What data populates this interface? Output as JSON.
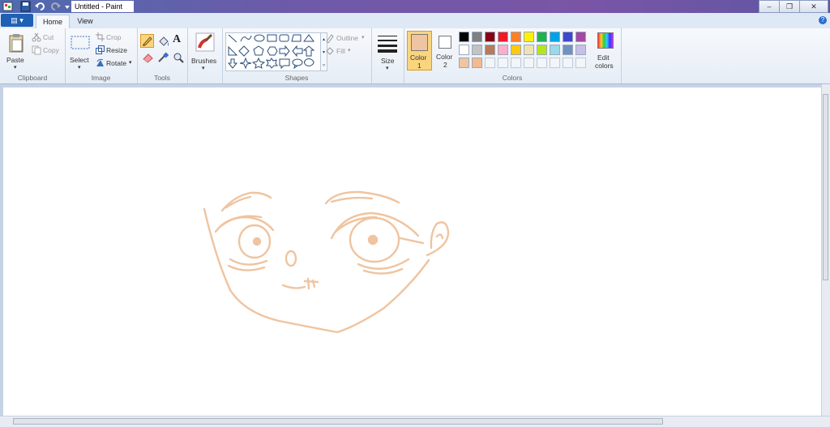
{
  "window": {
    "title": "Untitled - Paint"
  },
  "tabs": {
    "home": "Home",
    "view": "View"
  },
  "clipboard": {
    "paste": "Paste",
    "cut": "Cut",
    "copy": "Copy",
    "label": "Clipboard"
  },
  "image": {
    "select": "Select",
    "crop": "Crop",
    "resize": "Resize",
    "rotate": "Rotate",
    "label": "Image"
  },
  "tools": {
    "label": "Tools"
  },
  "brushes": {
    "label": "Brushes"
  },
  "shapes": {
    "outline": "Outline",
    "fill": "Fill",
    "label": "Shapes"
  },
  "size": {
    "label": "Size"
  },
  "colors": {
    "color1": "Color",
    "color1_num": "1",
    "color2": "Color",
    "color2_num": "2",
    "edit": "Edit",
    "edit2": "colors",
    "label": "Colors",
    "color1_value": "#efc4a0",
    "color2_value": "#ffffff",
    "palette_row1": [
      "#000000",
      "#7f7f7f",
      "#880015",
      "#ed1c24",
      "#ff7f27",
      "#fff200",
      "#22b14c",
      "#00a2e8",
      "#3f48cc",
      "#a349a4"
    ],
    "palette_row2": [
      "#ffffff",
      "#c3c3c3",
      "#b97a57",
      "#ffaec9",
      "#ffc90e",
      "#efe4b0",
      "#b5e61d",
      "#99d9ea",
      "#7092be",
      "#c8bfe7"
    ],
    "custom": [
      "#efc4a0",
      "#f5b98e"
    ]
  },
  "drawing": {
    "stroke_color": "#efc49f"
  }
}
